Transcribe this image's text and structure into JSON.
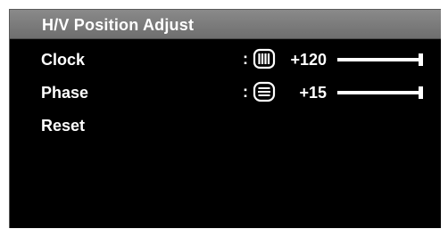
{
  "menu": {
    "title": "H/V Position Adjust",
    "items": [
      {
        "label": "Clock",
        "separator": ":",
        "icon": "clock-phase-bars-icon",
        "value": "+120",
        "level": 1.0
      },
      {
        "label": "Phase",
        "separator": ":",
        "icon": "phase-lines-icon",
        "value": "+15",
        "level": 1.0
      },
      {
        "label": "Reset"
      }
    ]
  },
  "colors": {
    "background": "#000000",
    "title_bar": "#7a7a7a",
    "text": "#ffffff"
  }
}
